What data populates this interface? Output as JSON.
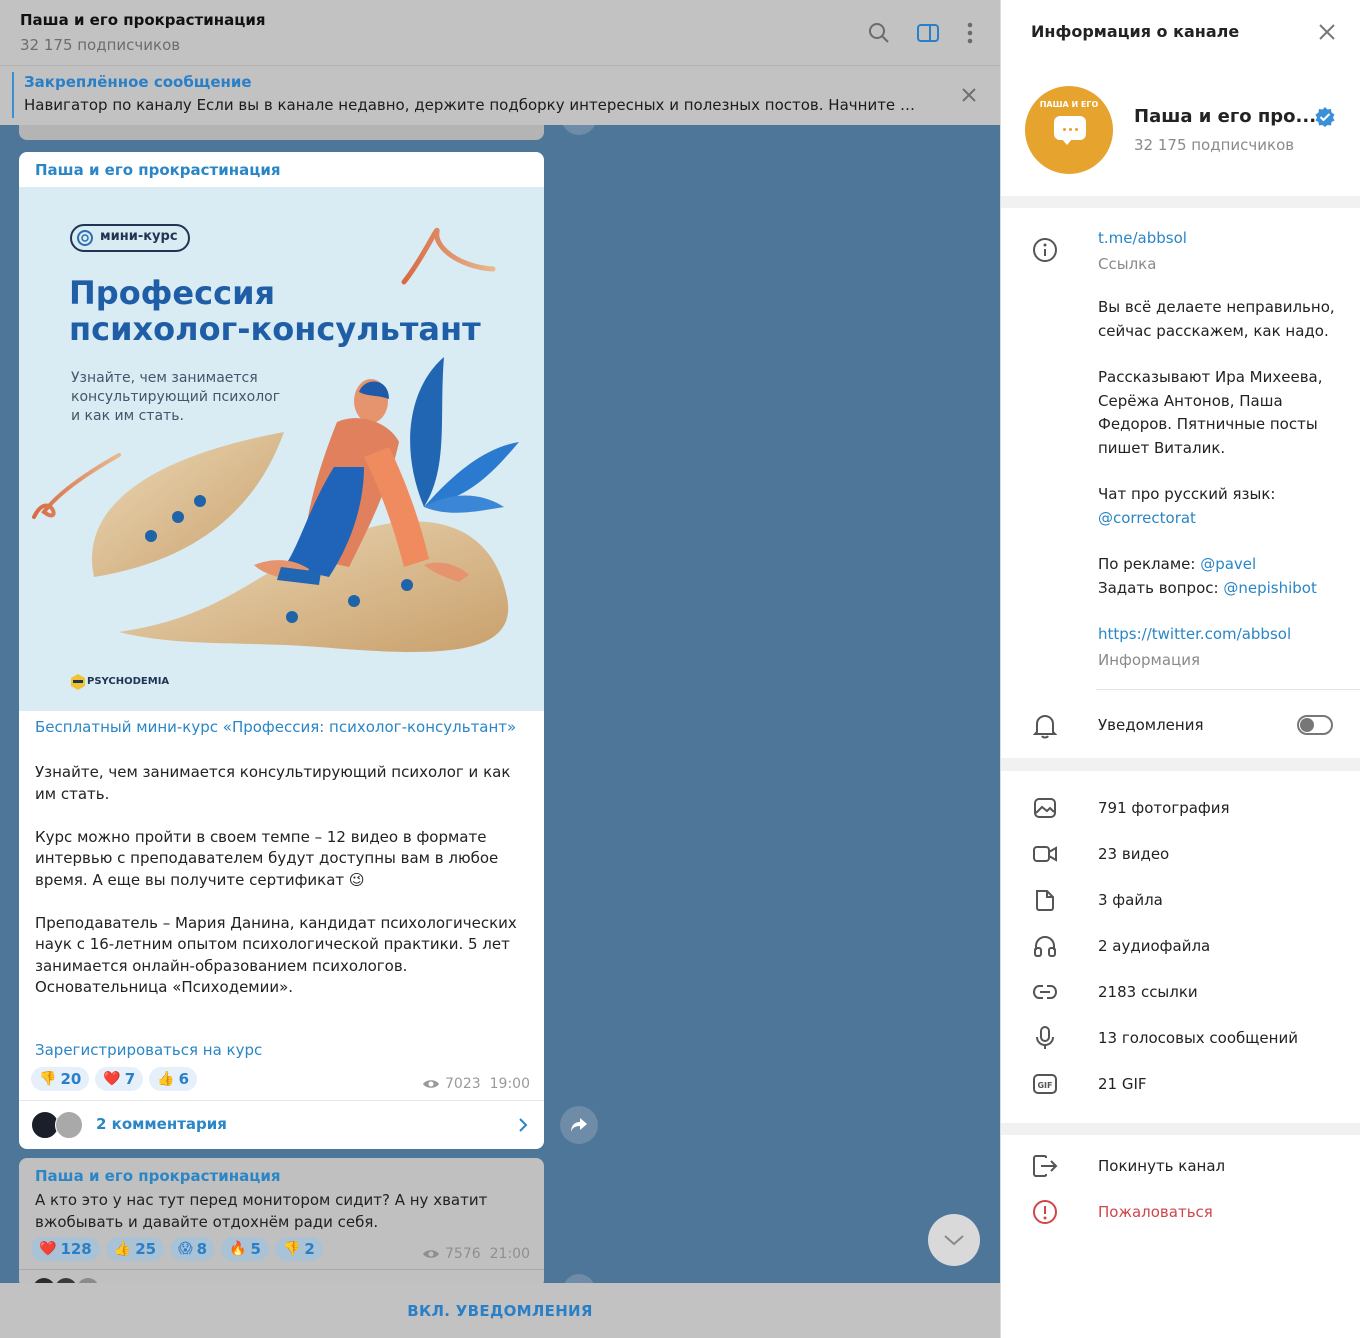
{
  "header": {
    "title": "Паша и его прокрастинация",
    "subtitle": "32 175 подписчиков",
    "icons": [
      "search-icon",
      "sidebar-toggle-icon",
      "more-vert-icon"
    ]
  },
  "pinned": {
    "title": "Закреплённое сообщение",
    "text": "Навигатор по каналу  Если вы в канале недавно, держите подборку интересных и полезных постов. Начните именн..."
  },
  "post": {
    "channel": "Паша и его прокрастинация",
    "poster": {
      "badge": "мини-курс",
      "heading_line1": "Профессия",
      "heading_line2": "психолог-консультант",
      "subtext_line1": "Узнайте, чем занимается",
      "subtext_line2": "консультирующий психолог",
      "subtext_line3": "и как им стать.",
      "logo": "PSYCHODEMIA"
    },
    "link_title": "Бесплатный мини-курс «Профессия: психолог-консультант»",
    "text": "Узнайте, чем занимается консультирующий психолог и как им стать.\n\nКурс можно пройти в своем темпе – 12 видео в формате интервью с преподавателем будут доступны вам в любое время. А еще вы получите сертификат 😉\n\nПреподаватель – Мария Данина, кандидат психологических наук с 16-летним опытом психологической практики. 5 лет занимается онлайн-образованием психологов. Основательница «Психодемии».",
    "register_link": "Зарегистрироваться на курс",
    "reactions": [
      {
        "emoji": "👎",
        "count": "20"
      },
      {
        "emoji": "❤️",
        "count": "7"
      },
      {
        "emoji": "👍",
        "count": "6"
      }
    ],
    "views": "7023",
    "time": "19:00",
    "comments": "2 комментария"
  },
  "next_post": {
    "channel": "Паша и его прокрастинация",
    "text": "А кто это у нас тут перед монитором сидит? А ну хватит вжобывать и давайте отдохнём ради себя.",
    "reactions": [
      {
        "emoji": "❤️",
        "count": "128"
      },
      {
        "emoji": "👍",
        "count": "25"
      },
      {
        "emoji": "😱",
        "count": "8"
      },
      {
        "emoji": "🔥",
        "count": "5"
      },
      {
        "emoji": "👎",
        "count": "2"
      }
    ],
    "views": "7576",
    "time": "21:00"
  },
  "bottom_bar": {
    "label": "ВКЛ. УВЕДОМЛЕНИЯ"
  },
  "info_panel": {
    "title": "Информация о канале",
    "channel_name": "Паша и его про...",
    "subscribers": "32 175 подписчиков",
    "avatar_text": "ПАША И ЕГО",
    "link": "t.me/abbsol",
    "link_caption": "Ссылка",
    "desc_p1": "Вы всё делаете неправильно, сейчас расскажем, как надо.",
    "desc_p2": "Рассказывают Ира Михеева, Серёжа Антонов, Паша Федоров. Пятничные посты пишет Виталик.",
    "desc_chat": "Чат про русский язык:",
    "desc_chat_handle": "@correctorat",
    "desc_ads": "По рекламе:",
    "desc_ads_handle": "@pavel",
    "desc_ask": "Задать вопрос:",
    "desc_ask_handle": "@nepishibot",
    "twitter": "https://twitter.com/abbsol",
    "twitter_caption": "Информация",
    "notifications": "Уведомления",
    "notifications_on": false,
    "media": [
      {
        "icon": "photo-icon",
        "label": "791 фотография"
      },
      {
        "icon": "video-icon",
        "label": "23 видео"
      },
      {
        "icon": "file-icon",
        "label": "3 файла"
      },
      {
        "icon": "headphones-icon",
        "label": "2 аудиофайла"
      },
      {
        "icon": "link-icon",
        "label": "2183 ссылки"
      },
      {
        "icon": "microphone-icon",
        "label": "13 голосовых сообщений"
      },
      {
        "icon": "gif-icon",
        "label": "21 GIF"
      }
    ],
    "leave": "Покинуть канал",
    "report": "Пожаловаться"
  },
  "colors": {
    "accent": "#2a86c6",
    "chat_bg": "#4e7698",
    "danger": "#d0454a"
  }
}
